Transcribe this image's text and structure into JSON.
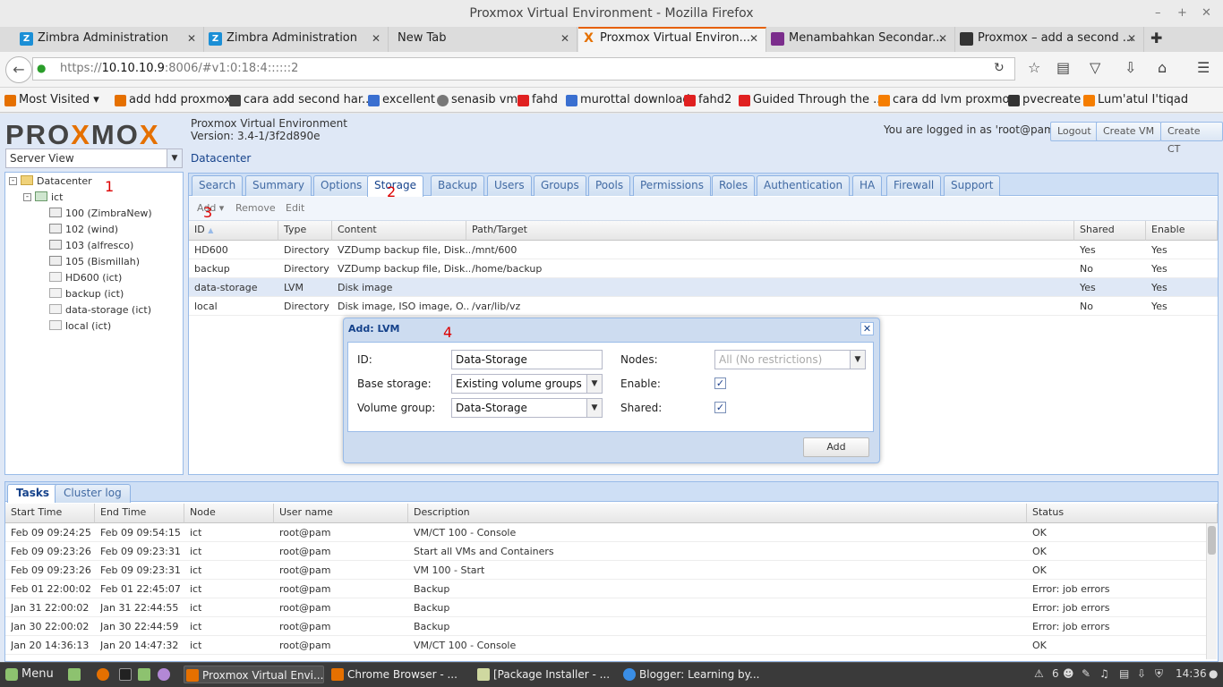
{
  "window": {
    "title": "Proxmox Virtual Environment - Mozilla Firefox"
  },
  "browser_tabs": [
    {
      "label": "Zimbra Administration",
      "icon": "zimbra-icon",
      "color": "#1b8fd6"
    },
    {
      "label": "Zimbra Administration",
      "icon": "zimbra-icon",
      "color": "#1b8fd6"
    },
    {
      "label": "New Tab",
      "icon": "",
      "color": ""
    },
    {
      "label": "Proxmox Virtual Environ...",
      "icon": "proxmox-icon",
      "color": "#e57000"
    },
    {
      "label": "Menambahkan Secondar...",
      "icon": "blog-icon",
      "color": "#7b2d8c"
    },
    {
      "label": "Proxmox – add a second ...",
      "icon": "linux-icon",
      "color": "#333333"
    }
  ],
  "url": {
    "prefix": "https://",
    "host": "10.10.10.9",
    "rest": ":8006/#v1:0:18:4::::::2"
  },
  "bookmarks": [
    {
      "label": "Most Visited",
      "color": "#e57000"
    },
    {
      "label": "add hdd proxmox",
      "color": "#e57000"
    },
    {
      "label": "cara add second har...",
      "color": "#444444"
    },
    {
      "label": "excellent",
      "color": "#3a6fd0"
    },
    {
      "label": "senasib vm",
      "color": "#777777"
    },
    {
      "label": "fahd",
      "color": "#e02020"
    },
    {
      "label": "murottal download",
      "color": "#3a6fd0"
    },
    {
      "label": "fahd2",
      "color": "#e02020"
    },
    {
      "label": "Guided Through the ...",
      "color": "#e02020"
    },
    {
      "label": "cara dd lvm proxmox",
      "color": "#f57d00"
    },
    {
      "label": "pvecreate",
      "color": "#333333"
    },
    {
      "label": "Lum'atul I'tiqad",
      "color": "#f57d00"
    }
  ],
  "app": {
    "logo_a": "PRO",
    "logo_b": "X",
    "logo_c": "MO",
    "logo_d": "X",
    "product": "Proxmox Virtual Environment",
    "version": "Version: 3.4-1/3f2d890e",
    "logged_in": "You are logged in as 'root@pam'",
    "buttons": {
      "logout": "Logout",
      "create_vm": "Create VM",
      "create_ct": "Create CT"
    },
    "server_view": "Server View",
    "breadcrumb": "Datacenter"
  },
  "tree": {
    "datacenter": "Datacenter",
    "node": "ict",
    "items": [
      {
        "label": "100 (ZimbraNew)",
        "kind": "vm"
      },
      {
        "label": "102 (wind)",
        "kind": "vm"
      },
      {
        "label": "103 (alfresco)",
        "kind": "vm"
      },
      {
        "label": "105 (Bismillah)",
        "kind": "vm"
      },
      {
        "label": "HD600 (ict)",
        "kind": "store"
      },
      {
        "label": "backup (ict)",
        "kind": "store"
      },
      {
        "label": "data-storage (ict)",
        "kind": "store"
      },
      {
        "label": "local (ict)",
        "kind": "store"
      }
    ]
  },
  "markers": {
    "m1": "1",
    "m2": "2",
    "m3": "3",
    "m4": "4"
  },
  "main_tabs": [
    "Search",
    "Summary",
    "Options",
    "Storage",
    "Backup",
    "Users",
    "Groups",
    "Pools",
    "Permissions",
    "Roles",
    "Authentication",
    "HA",
    "Firewall",
    "Support"
  ],
  "toolbar": {
    "add": "Add",
    "remove": "Remove",
    "edit": "Edit"
  },
  "storage_grid": {
    "headers": [
      "ID",
      "Type",
      "Content",
      "Path/Target",
      "Shared",
      "Enable"
    ],
    "rows": [
      [
        "HD600",
        "Directory",
        "VZDump backup file, Disk...",
        "/mnt/600",
        "Yes",
        "Yes"
      ],
      [
        "backup",
        "Directory",
        "VZDump backup file, Disk...",
        "/home/backup",
        "No",
        "Yes"
      ],
      [
        "data-storage",
        "LVM",
        "Disk image",
        "",
        "Yes",
        "Yes"
      ],
      [
        "local",
        "Directory",
        "Disk image, ISO image, O...",
        "/var/lib/vz",
        "No",
        "Yes"
      ]
    ]
  },
  "dialog": {
    "title": "Add: LVM",
    "id_label": "ID:",
    "id_value": "Data-Storage",
    "base_label": "Base storage:",
    "base_value": "Existing volume groups",
    "vg_label": "Volume group:",
    "vg_value": "Data-Storage",
    "nodes_label": "Nodes:",
    "nodes_placeholder": "All (No restrictions)",
    "enable_label": "Enable:",
    "shared_label": "Shared:",
    "add_button": "Add"
  },
  "task_tabs": [
    "Tasks",
    "Cluster log"
  ],
  "tasks": {
    "headers": [
      "Start Time",
      "End Time",
      "Node",
      "User name",
      "Description",
      "Status"
    ],
    "rows": [
      [
        "Feb 09 09:24:25",
        "Feb 09 09:54:15",
        "ict",
        "root@pam",
        "VM/CT 100 - Console",
        "OK"
      ],
      [
        "Feb 09 09:23:26",
        "Feb 09 09:23:31",
        "ict",
        "root@pam",
        "Start all VMs and Containers",
        "OK"
      ],
      [
        "Feb 09 09:23:26",
        "Feb 09 09:23:31",
        "ict",
        "root@pam",
        "VM 100 - Start",
        "OK"
      ],
      [
        "Feb 01 22:00:02",
        "Feb 01 22:45:07",
        "ict",
        "root@pam",
        "Backup",
        "Error: job errors"
      ],
      [
        "Jan 31 22:00:02",
        "Jan 31 22:44:55",
        "ict",
        "root@pam",
        "Backup",
        "Error: job errors"
      ],
      [
        "Jan 30 22:00:02",
        "Jan 30 22:44:59",
        "ict",
        "root@pam",
        "Backup",
        "Error: job errors"
      ],
      [
        "Jan 20 14:36:13",
        "Jan 20 14:47:32",
        "ict",
        "root@pam",
        "VM/CT 100 - Console",
        "OK"
      ]
    ]
  },
  "taskbar": {
    "menu": "Menu",
    "windows": [
      {
        "label": "Proxmox Virtual Envi...",
        "color": "#e57000"
      },
      {
        "label": "Chrome Browser - ...",
        "color": "#e57000"
      },
      {
        "label": "[Package Installer - ...",
        "color": "#cfd8a0"
      },
      {
        "label": "Blogger: Learning by...",
        "color": "#3a8ee6"
      }
    ],
    "count": "6",
    "clock": "14:36"
  },
  "colors": {
    "accent": "#e57000",
    "marker": "#dd0000",
    "panel_border": "#99bbe8"
  }
}
